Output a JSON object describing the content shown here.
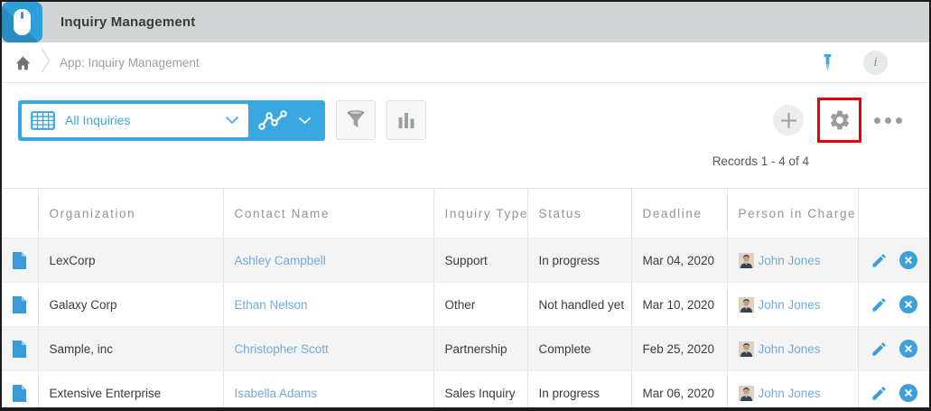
{
  "app": {
    "title": "Inquiry Management"
  },
  "breadcrumb": {
    "app_label": "App: Inquiry Management"
  },
  "toolbar": {
    "view_selector": {
      "selected_view": "All Inquiries"
    }
  },
  "records_summary": "Records 1 - 4 of 4",
  "table": {
    "columns": [
      "Organization",
      "Contact Name",
      "Inquiry Type",
      "Status",
      "Deadline",
      "Person in Charge"
    ],
    "rows": [
      {
        "organization": "LexCorp",
        "contact_name": "Ashley Campbell",
        "inquiry_type": "Support",
        "status": "In progress",
        "deadline": "Mar 04, 2020",
        "person_in_charge": "John Jones"
      },
      {
        "organization": "Galaxy Corp",
        "contact_name": "Ethan Nelson",
        "inquiry_type": "Other",
        "status": "Not handled yet",
        "deadline": "Mar 10, 2020",
        "person_in_charge": "John Jones"
      },
      {
        "organization": "Sample, inc",
        "contact_name": "Christopher Scott",
        "inquiry_type": "Partnership",
        "status": "Complete",
        "deadline": "Feb 25, 2020",
        "person_in_charge": "John Jones"
      },
      {
        "organization": "Extensive Enterprise",
        "contact_name": "Isabella Adams",
        "inquiry_type": "Sales Inquiry",
        "status": "In progress",
        "deadline": "Mar 06, 2020",
        "person_in_charge": "John Jones"
      }
    ]
  },
  "icons": {
    "app": "mouse-icon",
    "home": "home-icon",
    "pin": "pushpin-icon",
    "info": "info-icon",
    "view_list": "table-grid-icon",
    "view_graph": "line-graph-icon",
    "filter": "funnel-icon",
    "chart": "bar-chart-icon",
    "add": "plus-icon",
    "settings": "gear-icon",
    "more": "ellipsis-icon",
    "record": "document-icon",
    "edit": "pencil-icon",
    "delete": "circle-x-icon",
    "avatar": "person-photo"
  },
  "colors": {
    "accent_blue": "#3ba7e0",
    "link_blue": "#74aadd",
    "header_gray": "#d2d5d5",
    "annotation_red": "#e80000"
  },
  "annotation": {
    "highlighted_control": "settings-button"
  }
}
